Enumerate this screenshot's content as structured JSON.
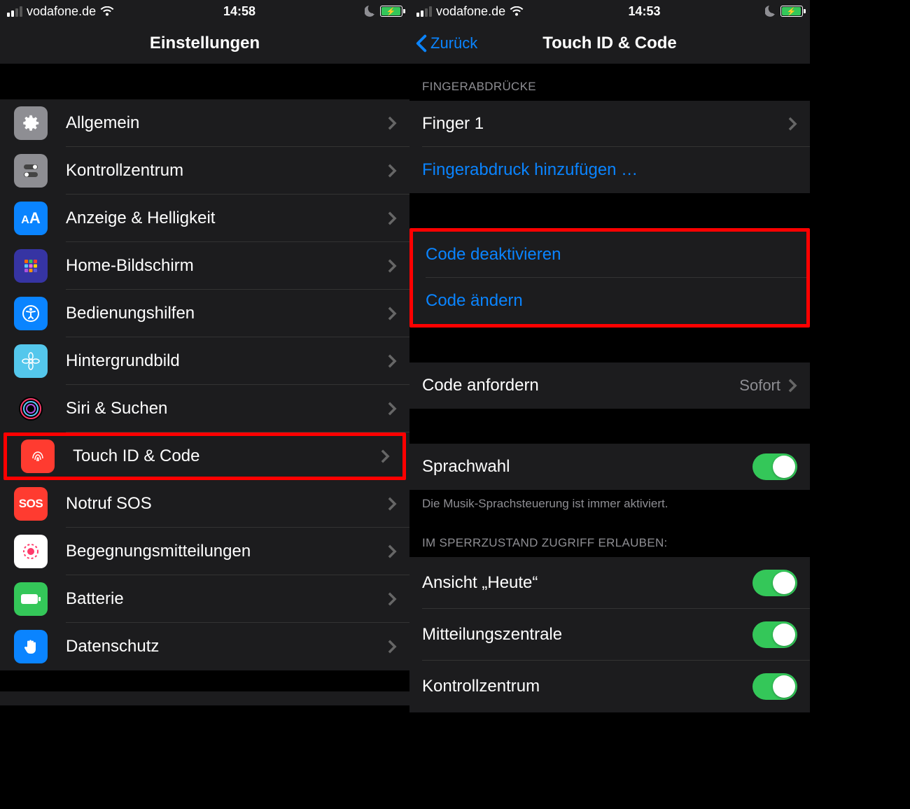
{
  "left": {
    "statusbar": {
      "carrier": "vodafone.de",
      "time": "14:58"
    },
    "nav": {
      "title": "Einstellungen"
    },
    "items": [
      {
        "label": "Allgemein"
      },
      {
        "label": "Kontrollzentrum"
      },
      {
        "label": "Anzeige & Helligkeit"
      },
      {
        "label": "Home-Bildschirm"
      },
      {
        "label": "Bedienungshilfen"
      },
      {
        "label": "Hintergrundbild"
      },
      {
        "label": "Siri & Suchen"
      },
      {
        "label": "Touch ID & Code"
      },
      {
        "label": "Notruf SOS"
      },
      {
        "label": "Begegnungsmitteilungen"
      },
      {
        "label": "Batterie"
      },
      {
        "label": "Datenschutz"
      }
    ]
  },
  "right": {
    "statusbar": {
      "carrier": "vodafone.de",
      "time": "14:53"
    },
    "nav": {
      "back": "Zurück",
      "title": "Touch ID & Code"
    },
    "sections": {
      "fingerprints_header": "FINGERABDRÜCKE",
      "finger1": "Finger 1",
      "add_finger": "Fingerabdruck hinzufügen …",
      "code_deactivate": "Code deaktivieren",
      "code_change": "Code ändern",
      "code_require_label": "Code anfordern",
      "code_require_value": "Sofort",
      "voicedial": "Sprachwahl",
      "voicedial_footer": "Die Musik-Sprachsteuerung ist immer aktiviert.",
      "lock_header": "IM SPERRZUSTAND ZUGRIFF ERLAUBEN:",
      "today": "Ansicht „Heute“",
      "notifications": "Mitteilungszentrale",
      "control": "Kontrollzentrum"
    }
  }
}
